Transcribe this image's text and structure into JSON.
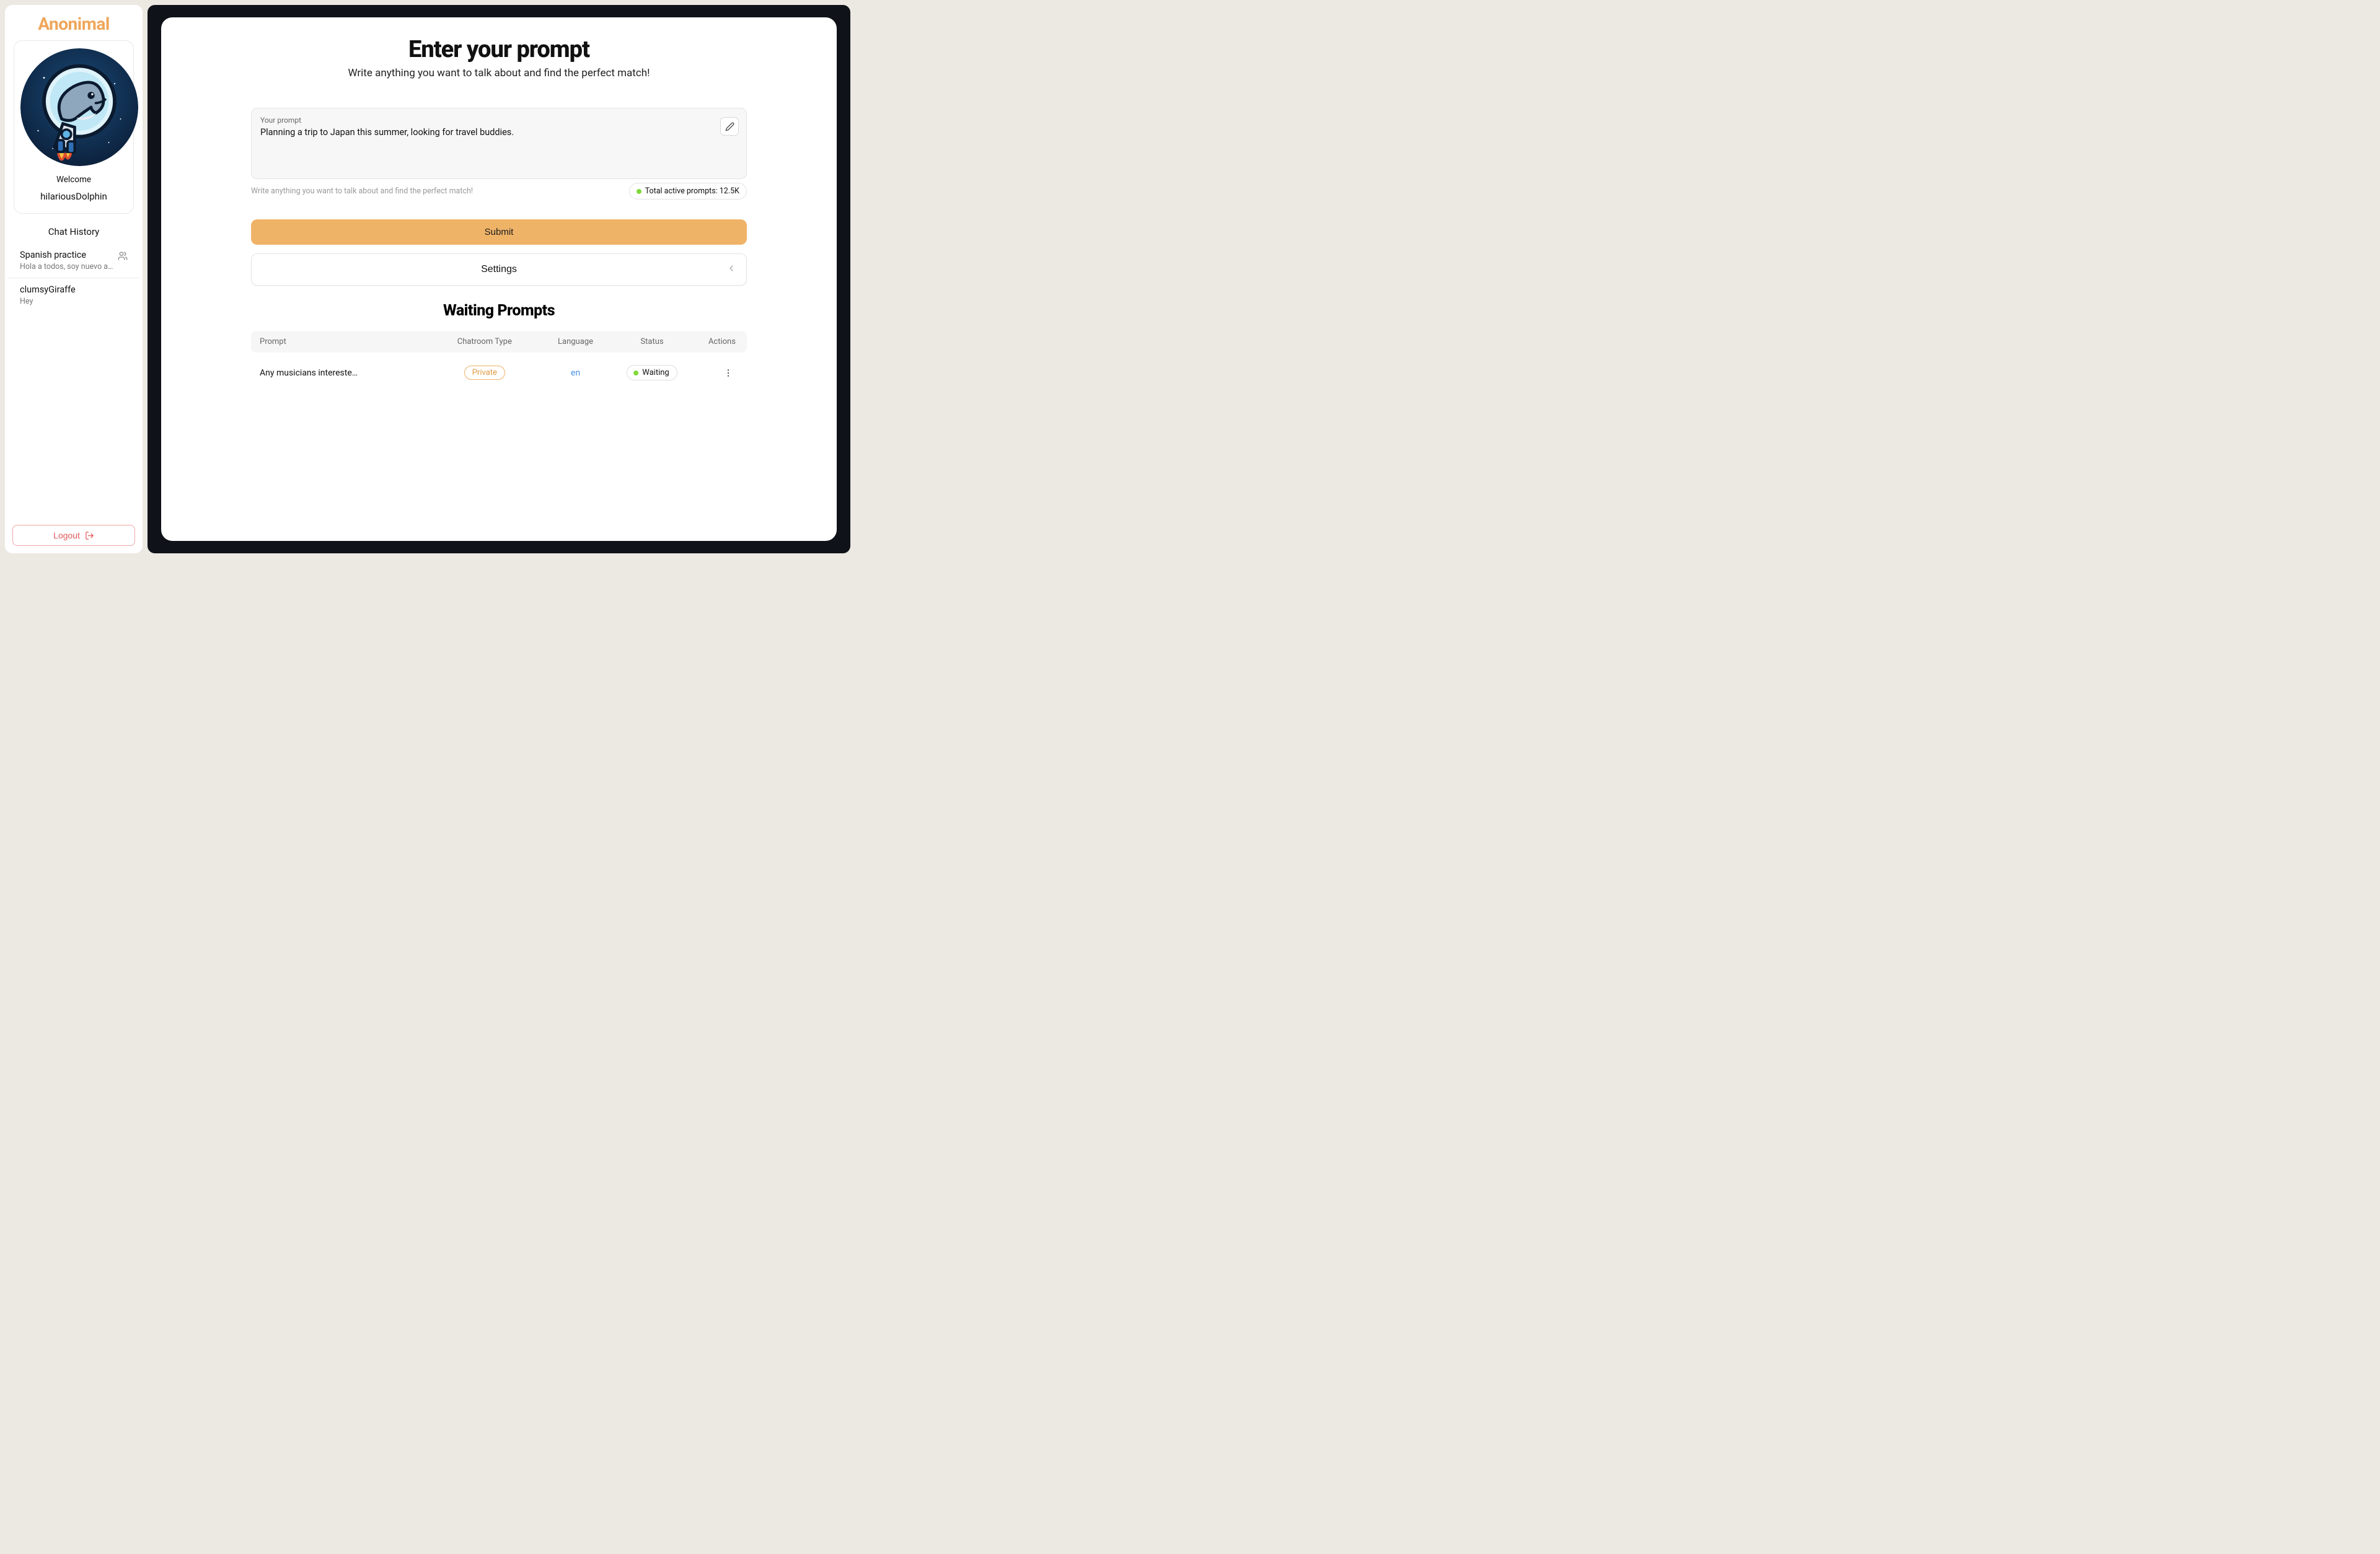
{
  "brand": "Anonimal",
  "sidebar": {
    "welcome_label": "Welcome",
    "username": "hilariousDolphin",
    "chat_history_title": "Chat History",
    "items": [
      {
        "title": "Spanish practice",
        "sub": "Hola a todos, soy nuevo aquí",
        "group": true
      },
      {
        "title": "clumsyGiraffe",
        "sub": "Hey",
        "group": false
      }
    ],
    "logout_label": "Logout"
  },
  "main": {
    "title": "Enter your prompt",
    "subtitle": "Write anything you want to talk about and find the perfect match!",
    "prompt": {
      "label": "Your prompt",
      "value": "Planning a trip to Japan this summer, looking for travel buddies.",
      "helper": "Write anything you want to talk about and find the perfect match!",
      "active_label": "Total active prompts: 12.5K"
    },
    "submit_label": "Submit",
    "settings_label": "Settings",
    "waiting": {
      "title": "Waiting Prompts",
      "columns": {
        "prompt": "Prompt",
        "type": "Chatroom Type",
        "lang": "Language",
        "status": "Status",
        "actions": "Actions"
      },
      "rows": [
        {
          "prompt": "Any musicians intereste…",
          "type": "Private",
          "lang": "en",
          "status": "Waiting"
        }
      ]
    }
  },
  "colors": {
    "accent": "#efb368",
    "brand": "#efa65a"
  }
}
